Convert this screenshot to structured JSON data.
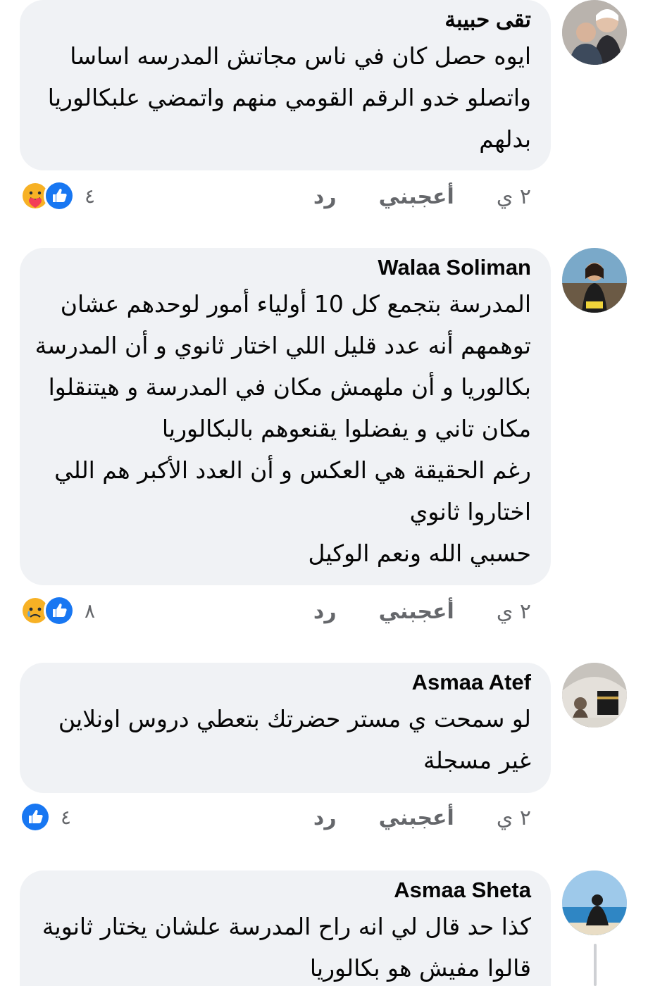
{
  "colors": {
    "bubble": "#f0f2f5",
    "text": "#050505",
    "meta": "#65676b",
    "like_blue": "#1877f2"
  },
  "comments": [
    {
      "author": "تقى حبيبة",
      "lines": [
        "ايوه حصل كان في ناس مجاتش المدرسه اساسا",
        "واتصلو خدو الرقم القومي منهم واتمضي علبكالوريا",
        "بدلهم"
      ],
      "time": "٢ ي",
      "like": "أعجبني",
      "reply": "رد",
      "reaction_count": "٤",
      "reactions": [
        "care-icon",
        "like-icon"
      ]
    },
    {
      "author": "Walaa Soliman",
      "lines": [
        "المدرسة بتجمع كل 10 أولياء أمور لوحدهم عشان",
        "توهمهم أنه عدد قليل اللي اختار ثانوي و أن المدرسة",
        "بكالوريا و أن ملهمش مكان في المدرسة و هيتنقلوا",
        "مكان تاني و يفضلوا يقنعوهم بالبكالوريا",
        "رغم الحقيقة هي العكس و أن العدد الأكبر هم اللي",
        "اختاروا ثانوي",
        "حسبي الله ونعم الوكيل"
      ],
      "time": "٢ ي",
      "like": "أعجبني",
      "reply": "رد",
      "reaction_count": "٨",
      "reactions": [
        "sad-icon",
        "like-icon"
      ]
    },
    {
      "author": "Asmaa Atef",
      "lines": [
        "لو سمحت ي مستر حضرتك بتعطي دروس اونلاين",
        "غير مسجلة"
      ],
      "time": "٢ ي",
      "like": "أعجبني",
      "reply": "رد",
      "reaction_count": "٤",
      "reactions": [
        "like-icon"
      ]
    },
    {
      "author": "Asmaa Sheta",
      "lines": [
        "كذا حد قال لي انه راح المدرسة علشان يختار ثانوية",
        "قالوا مفيش هو بكالوريا"
      ],
      "time": "",
      "like": "",
      "reply": "",
      "reaction_count": "",
      "reactions": []
    }
  ]
}
